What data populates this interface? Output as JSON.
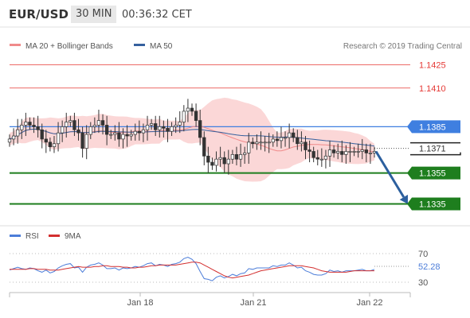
{
  "header": {
    "symbol": "EUR/USD",
    "timeframe": "30 MIN",
    "time": "00:36:32 CET"
  },
  "legend": {
    "ma20_label": "MA 20 + Bollinger Bands",
    "ma50_label": "MA 50",
    "credit": "Research © 2019 Trading Central"
  },
  "rsi_legend": {
    "rsi_label": "RSI",
    "ma9_label": "9MA"
  },
  "colors": {
    "red_level": "#e53935",
    "blue_level": "#3f7fe0",
    "green_level": "#1e7e1e",
    "ma20": "#f08a8a",
    "bollinger": "#f9c9c9",
    "ma50": "#35609e",
    "arrow": "#2c5f9e",
    "rsi": "#4c7dd9",
    "rsi_ma": "#d32f2f"
  },
  "chart_data": [
    {
      "type": "candlestick",
      "title": "",
      "y_range": [
        1.1325,
        1.1432
      ],
      "levels": [
        {
          "value": 1.1425,
          "label": "1.1425",
          "style": "resistance"
        },
        {
          "value": 1.141,
          "label": "1.1410",
          "style": "resistance"
        },
        {
          "value": 1.1385,
          "label": "1.1385",
          "style": "pivot"
        },
        {
          "value": 1.1355,
          "label": "1.1355",
          "style": "support"
        },
        {
          "value": 1.1335,
          "label": "1.1335",
          "style": "support"
        }
      ],
      "last_price": {
        "value": 1.1371,
        "label": "1.1371"
      },
      "x_ticks": [
        "Jan 18",
        "Jan 21",
        "Jan 22"
      ],
      "forecast": {
        "from": 1.1369,
        "to": 1.1335
      },
      "closes": [
        1.1377,
        1.1379,
        1.1383,
        1.1386,
        1.1388,
        1.1386,
        1.1385,
        1.1383,
        1.1377,
        1.1375,
        1.1372,
        1.1374,
        1.1381,
        1.1385,
        1.1388,
        1.1389,
        1.1383,
        1.1381,
        1.1371,
        1.138,
        1.1385,
        1.1386,
        1.1389,
        1.1386,
        1.138,
        1.138,
        1.1381,
        1.1377,
        1.138,
        1.1379,
        1.138,
        1.1382,
        1.1381,
        1.1383,
        1.1386,
        1.1387,
        1.1383,
        1.1385,
        1.1384,
        1.1382,
        1.1385,
        1.1386,
        1.1388,
        1.1395,
        1.1397,
        1.1395,
        1.1389,
        1.1378,
        1.1366,
        1.1362,
        1.136,
        1.1364,
        1.1365,
        1.1361,
        1.1364,
        1.1367,
        1.1364,
        1.1367,
        1.1368,
        1.1375,
        1.1374,
        1.1375,
        1.1375,
        1.1375,
        1.1375,
        1.1377,
        1.1376,
        1.1378,
        1.1378,
        1.1381,
        1.1378,
        1.1374,
        1.1375,
        1.137,
        1.1369,
        1.1365,
        1.1364,
        1.1364,
        1.1366,
        1.137,
        1.1368,
        1.1369,
        1.1367,
        1.1369,
        1.1369,
        1.1369,
        1.1369,
        1.137,
        1.1368,
        1.1368,
        1.1369
      ]
    },
    {
      "type": "line",
      "title": "",
      "y_range": [
        20,
        80
      ],
      "y_ticks": [
        70,
        30
      ],
      "last_value": {
        "value": 52.28,
        "label": "52.28"
      },
      "series": [
        {
          "name": "RSI",
          "values": [
            47,
            49,
            51,
            49,
            48,
            50,
            49,
            46,
            44,
            47,
            43,
            45,
            50,
            53,
            55,
            56,
            50,
            51,
            44,
            51,
            54,
            55,
            57,
            54,
            49,
            49,
            50,
            47,
            50,
            49,
            50,
            52,
            51,
            53,
            56,
            57,
            53,
            55,
            54,
            52,
            55,
            56,
            58,
            63,
            65,
            62,
            56,
            45,
            35,
            34,
            32,
            37,
            39,
            36,
            38,
            41,
            39,
            42,
            43,
            49,
            48,
            50,
            50,
            50,
            50,
            53,
            52,
            54,
            54,
            57,
            54,
            50,
            51,
            46,
            44,
            41,
            40,
            40,
            42,
            47,
            45,
            46,
            44,
            46,
            46,
            46,
            47,
            48,
            46,
            46,
            48
          ]
        },
        {
          "name": "9MA",
          "values": [
            48,
            48,
            48,
            48,
            48,
            49,
            49,
            48,
            48,
            48,
            47,
            47,
            47,
            48,
            49,
            50,
            51,
            52,
            51,
            51,
            51,
            52,
            52,
            53,
            53,
            52,
            52,
            52,
            51,
            51,
            50,
            50,
            51,
            51,
            52,
            53,
            53,
            54,
            54,
            54,
            54,
            54,
            55,
            56,
            57,
            58,
            58,
            57,
            54,
            51,
            48,
            45,
            42,
            39,
            37,
            36,
            37,
            38,
            39,
            40,
            42,
            44,
            46,
            47,
            48,
            49,
            50,
            51,
            52,
            53,
            53,
            53,
            53,
            52,
            51,
            50,
            48,
            46,
            45,
            44,
            44,
            44,
            44,
            44,
            45,
            46,
            46,
            46,
            46,
            46,
            46
          ]
        }
      ]
    }
  ]
}
